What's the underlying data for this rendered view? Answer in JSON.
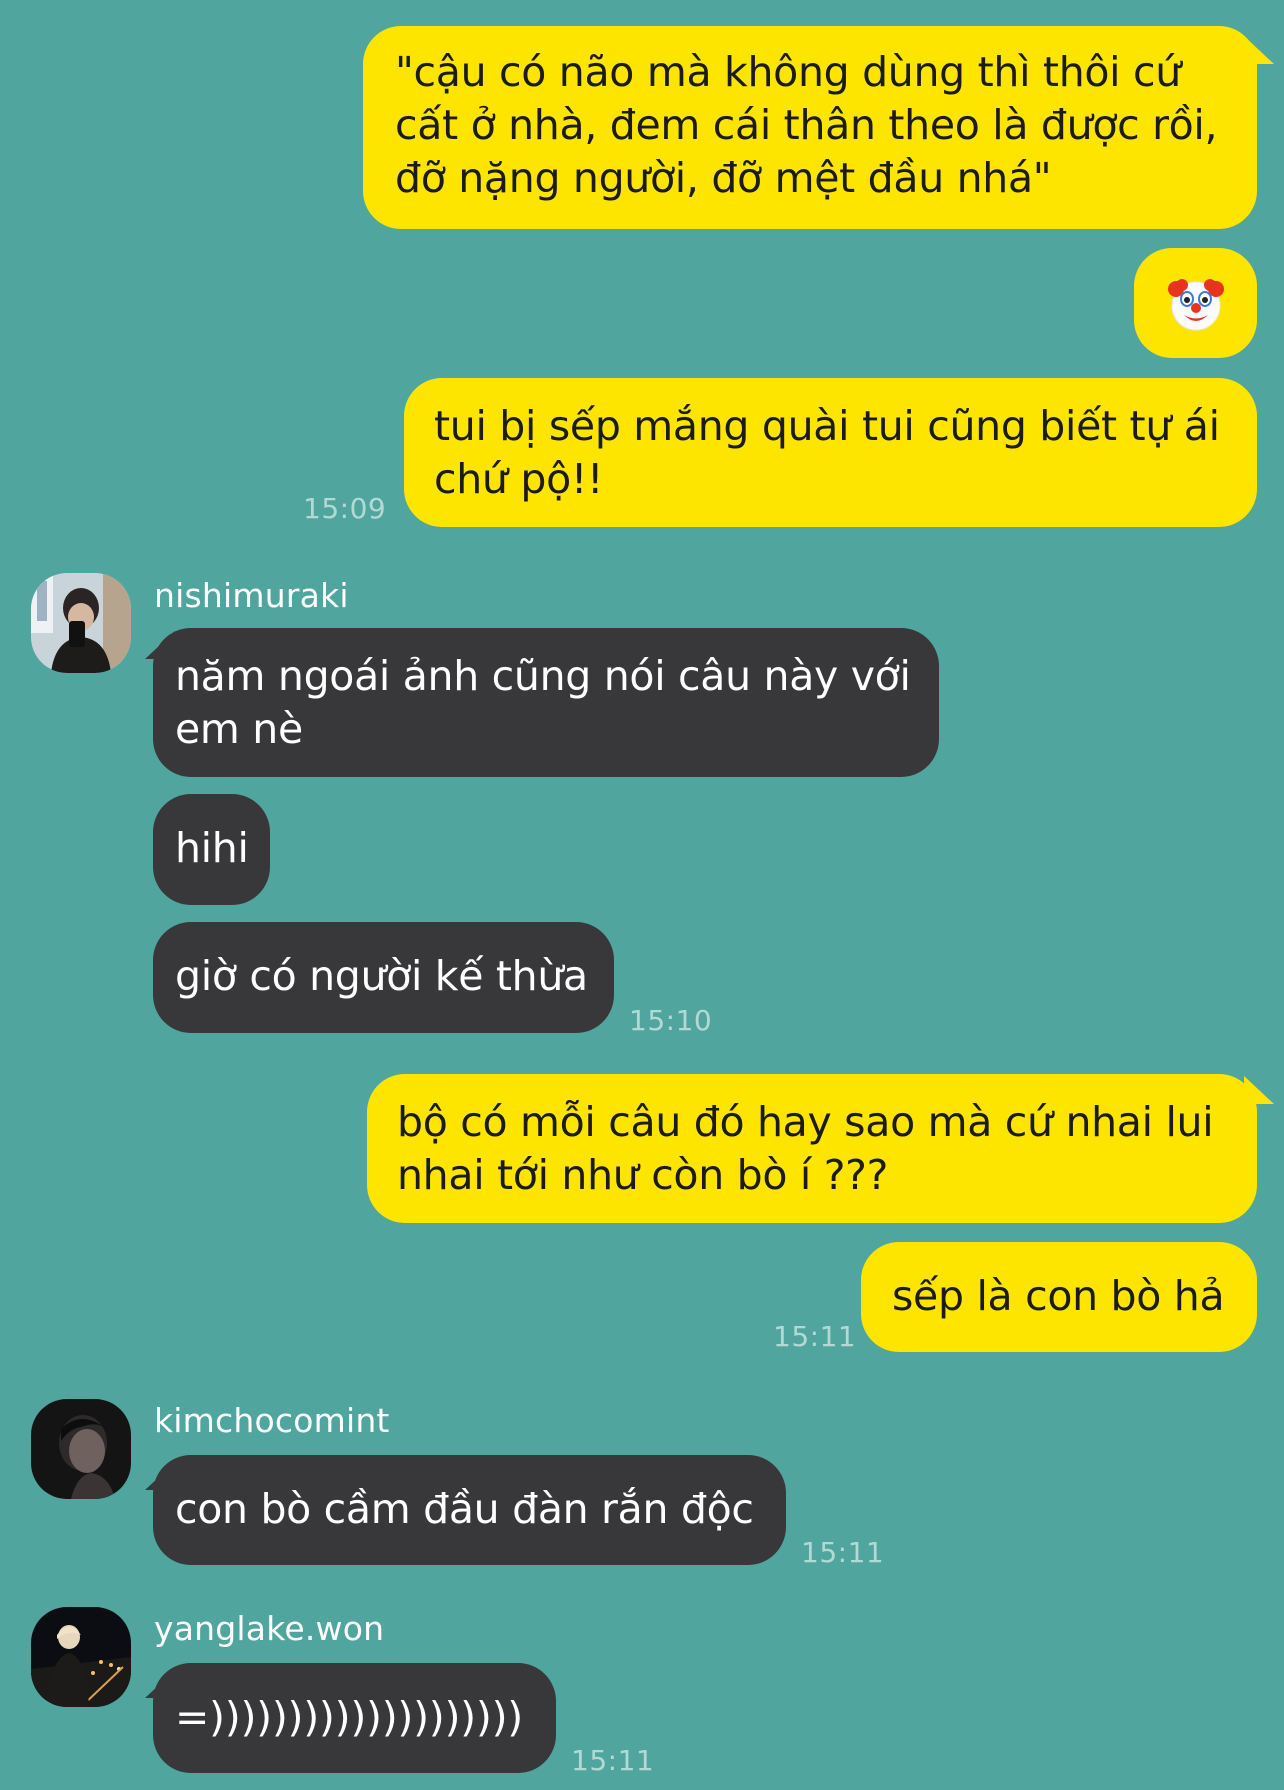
{
  "messages": [
    {
      "id": "m1",
      "direction": "outgoing",
      "text": "\"cậu có não mà không dùng thì thôi cứ cất ở nhà, đem cái thân theo là được rồi, đỡ nặng người, đỡ mệt đầu nhá\""
    },
    {
      "id": "m2",
      "direction": "outgoing",
      "emoji": "clown-face"
    },
    {
      "id": "m3",
      "direction": "outgoing",
      "text": "tui bị sếp mắng quài tui cũng biết tự ái chứ pộ!!",
      "time": "15:09"
    },
    {
      "id": "m4",
      "direction": "incoming",
      "sender": "nishimuraki",
      "text": "năm ngoái ảnh cũng nói câu này với em nè"
    },
    {
      "id": "m5",
      "direction": "incoming",
      "text": "hihi"
    },
    {
      "id": "m6",
      "direction": "incoming",
      "text": "giờ có người kế thừa",
      "time": "15:10"
    },
    {
      "id": "m7",
      "direction": "outgoing",
      "text": "bộ có mỗi câu đó hay sao mà cứ nhai lui nhai tới như còn bò í ???"
    },
    {
      "id": "m8",
      "direction": "outgoing",
      "text": "sếp là con bò hả",
      "time": "15:11"
    },
    {
      "id": "m9",
      "direction": "incoming",
      "sender": "kimchocomint",
      "text": "con bò cầm đầu đàn rắn độc",
      "time": "15:11"
    },
    {
      "id": "m10",
      "direction": "incoming",
      "sender": "yanglake.won",
      "text": "=))))))))))))))))))))",
      "time": "15:11"
    }
  ],
  "colors": {
    "background": "#50a69f",
    "outgoing_bubble": "#fee500",
    "incoming_bubble": "#38383a",
    "timestamp": "#b3d9d5"
  }
}
